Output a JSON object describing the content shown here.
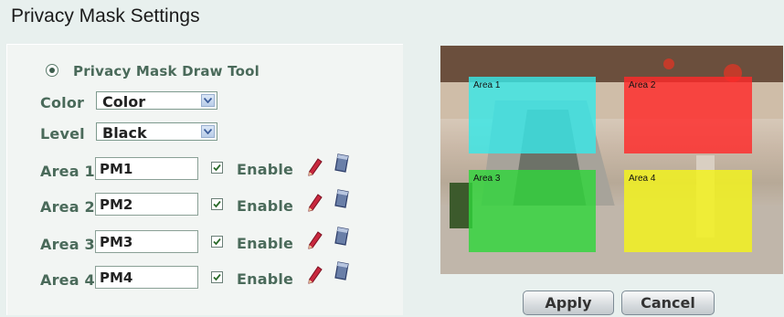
{
  "page": {
    "title": "Privacy Mask Settings"
  },
  "draw_tool": {
    "label": "Privacy Mask Draw Tool",
    "selected": true
  },
  "color": {
    "label": "Color",
    "value": "Color"
  },
  "level": {
    "label": "Level",
    "value": "Black"
  },
  "areas": [
    {
      "label": "Area 1",
      "name": "PM1",
      "enabled": true,
      "enable_label": "Enable",
      "overlay_label": "Area 1",
      "overlay_color": "#38e8e8"
    },
    {
      "label": "Area 2",
      "name": "PM2",
      "enabled": true,
      "enable_label": "Enable",
      "overlay_label": "Area 2",
      "overlay_color": "#ff2a2a"
    },
    {
      "label": "Area 3",
      "name": "PM3",
      "enabled": true,
      "enable_label": "Enable",
      "overlay_label": "Area 3",
      "overlay_color": "#2fd63a"
    },
    {
      "label": "Area 4",
      "name": "PM4",
      "enabled": true,
      "enable_label": "Enable",
      "overlay_label": "Area 4",
      "overlay_color": "#f2f21e"
    }
  ],
  "buttons": {
    "apply": "Apply",
    "cancel": "Cancel"
  },
  "icons": {
    "draw": "pencil-icon",
    "clear": "eraser-icon"
  }
}
